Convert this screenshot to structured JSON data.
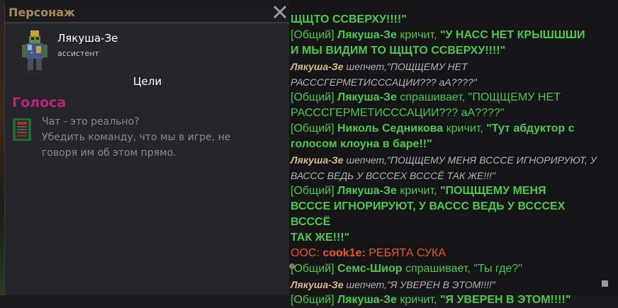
{
  "character_window": {
    "title": "Персонаж",
    "name": "Лякуша-Зе",
    "job": "ассистент",
    "objectives_title": "Цели",
    "section_title": "Голоса",
    "objective_lines": [
      "Чат - это реально?",
      "Убедить команду, что мы в игре, не",
      "говоря им об этом прямо."
    ]
  },
  "chat": {
    "lines": [
      {
        "parts": [
          "ЩЩТО ССВЕРХУ!!!!\""
        ]
      },
      {
        "parts": [
          "[Общий] ",
          "Лякуша-Зе",
          " кричит, ",
          "\"У НАСС НЕТ КРЫШШШИ"
        ]
      },
      {
        "parts": [
          "И МЫ ВИДИМ ТО ЩЩТО ССВЕРХУ!!!!\""
        ]
      },
      {
        "parts": [
          "Лякуша-Зе",
          " шепчет,\"ПОЩЩЕМУ НЕТ"
        ]
      },
      {
        "parts": [
          "РАСССГЕРМЕТИСССАЦИИ??? аА????\""
        ]
      },
      {
        "parts": [
          "[Общий] ",
          "Лякуша-Зе",
          " спрашивает, ",
          "\"ПОЩЩЕМУ НЕТ"
        ]
      },
      {
        "parts": [
          "РАСССГЕРМЕТИСССАЦИИ??? аА????\""
        ]
      },
      {
        "parts": [
          "[Общий] ",
          "Николь Седникова",
          " кричит, ",
          "\"Тут абдуктор с"
        ]
      },
      {
        "parts": [
          "голосом клоуна в баре!!\""
        ]
      },
      {
        "parts": [
          "Лякуша-Зе",
          " шепчет,\"ПОЩЩЕМУ МЕНЯ ВСССЕ ИГНОРИРУЮТ, У"
        ]
      },
      {
        "parts": [
          "ВАССС ВЕДЬ У ВСССЕХ ВСССЁ ТАК ЖЕ!!!\""
        ]
      },
      {
        "parts": [
          "[Общий] ",
          "Лякуша-Зе",
          " кричит, ",
          "\"ПОЩЩЕМУ МЕНЯ"
        ]
      },
      {
        "parts": [
          "ВСССЕ ИГНОРИРУЮТ, У ВАССС ВЕДЬ У ВСССЕХ ВСССЁ"
        ]
      },
      {
        "parts": [
          "ТАК ЖЕ!!!\""
        ]
      },
      {
        "parts": [
          "OOC: ",
          "cook1e:",
          " РЕБЯТА СУКА"
        ]
      },
      {
        "parts": [
          "[Общий] ",
          "Семс-Шиор",
          " спрашивает, ",
          "\"Ты где?\""
        ]
      },
      {
        "parts": [
          "Лякуша-Зе",
          " шепчет,\"Я УВЕРЕН В ЭТОМ!!!!\""
        ]
      },
      {
        "parts": [
          "[Общий] ",
          "Лякуша-Зе",
          " кричит, ",
          "\"Я УВЕРЕН В ЭТОМ!!!!\""
        ]
      }
    ]
  },
  "colors": {
    "channel_green": "#4cc84c",
    "whisper_speaker": "#d9b98a",
    "ooc_orange": "#ea5a1e",
    "section_magenta": "#b5267a",
    "window_title": "#a88a5a"
  }
}
